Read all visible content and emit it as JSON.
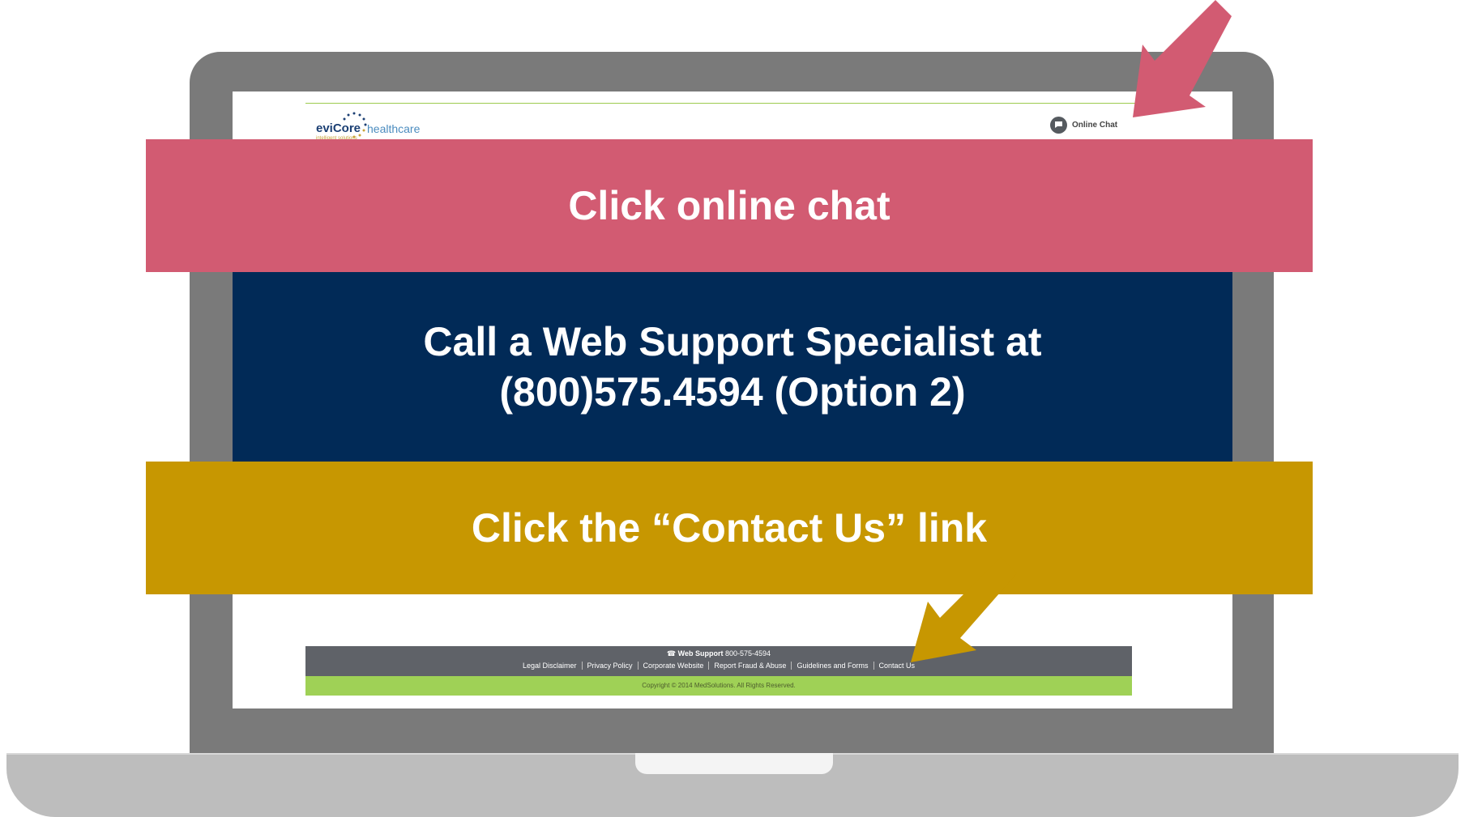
{
  "site": {
    "logo_brand": "eviCore",
    "logo_suffix": "healthcare",
    "logo_tagline": "intelligent solutions",
    "online_chat_label": "Online Chat",
    "footer": {
      "support_label": "Web Support",
      "support_phone": "800-575-4594",
      "links": [
        "Legal Disclaimer",
        "Privacy Policy",
        "Corporate Website",
        "Report Fraud & Abuse",
        "Guidelines and Forms",
        "Contact Us"
      ],
      "copyright": "Copyright © 2014 MedSolutions. All Rights Reserved."
    }
  },
  "overlay": {
    "chat_instruction": "Click online chat",
    "phone_line1": "Call a Web Support Specialist at",
    "phone_line2": "(800)575.4594 (Option 2)",
    "contact_instruction": "Click the “Contact Us” link"
  },
  "colors": {
    "pink_band": "#d25b72",
    "navy_band": "#012a57",
    "gold_band": "#c79701",
    "footer_gray": "#5f6268",
    "footer_green": "#9fd156"
  },
  "icons": [
    "chat-bubble-icon",
    "phone-icon",
    "pink-arrow-icon",
    "gold-arrow-icon"
  ]
}
